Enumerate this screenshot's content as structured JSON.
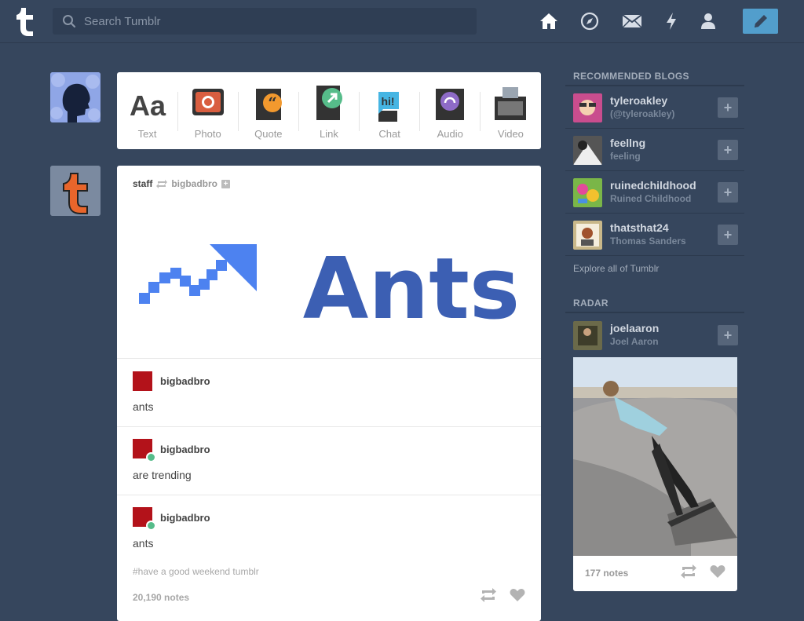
{
  "header": {
    "search_placeholder": "Search Tumblr",
    "nav": [
      "home-icon",
      "explore-icon",
      "inbox-icon",
      "activity-icon",
      "account-icon"
    ],
    "compose_icon": "pencil-icon"
  },
  "post_types": [
    {
      "label": "Text",
      "icon": "text-icon"
    },
    {
      "label": "Photo",
      "icon": "photo-icon"
    },
    {
      "label": "Quote",
      "icon": "quote-icon"
    },
    {
      "label": "Link",
      "icon": "link-icon"
    },
    {
      "label": "Chat",
      "icon": "chat-icon"
    },
    {
      "label": "Audio",
      "icon": "audio-icon"
    },
    {
      "label": "Video",
      "icon": "video-icon"
    }
  ],
  "post": {
    "author": "staff",
    "reblogged_from": "bigbadbro",
    "image_text": "Ants",
    "replies": [
      {
        "name": "bigbadbro",
        "text": "ants",
        "reblog": false
      },
      {
        "name": "bigbadbro",
        "text": "are trending",
        "reblog": true
      },
      {
        "name": "bigbadbro",
        "text": "ants",
        "reblog": true
      }
    ],
    "tags": "#have a good weekend tumblr",
    "notes": "20,190 notes"
  },
  "sidebar": {
    "recommended_title": "RECOMMENDED BLOGS",
    "blogs": [
      {
        "name": "tyleroakley",
        "subtitle": "(@tyleroakley)",
        "color": "#c94d8e"
      },
      {
        "name": "feellng",
        "subtitle": "feeling",
        "color": "#555555"
      },
      {
        "name": "ruinedchildhood",
        "subtitle": "Ruined Childhood",
        "color": "#7ab648"
      },
      {
        "name": "thatsthat24",
        "subtitle": "Thomas Sanders",
        "color": "#c9b88a"
      }
    ],
    "explore": "Explore all of Tumblr",
    "radar_title": "RADAR",
    "radar": {
      "name": "joelaaron",
      "subtitle": "Joel Aaron",
      "notes": "177 notes"
    }
  },
  "colors": {
    "background": "#36465d",
    "accent": "#529ecc",
    "reblog_badge": "#56bc8a"
  }
}
